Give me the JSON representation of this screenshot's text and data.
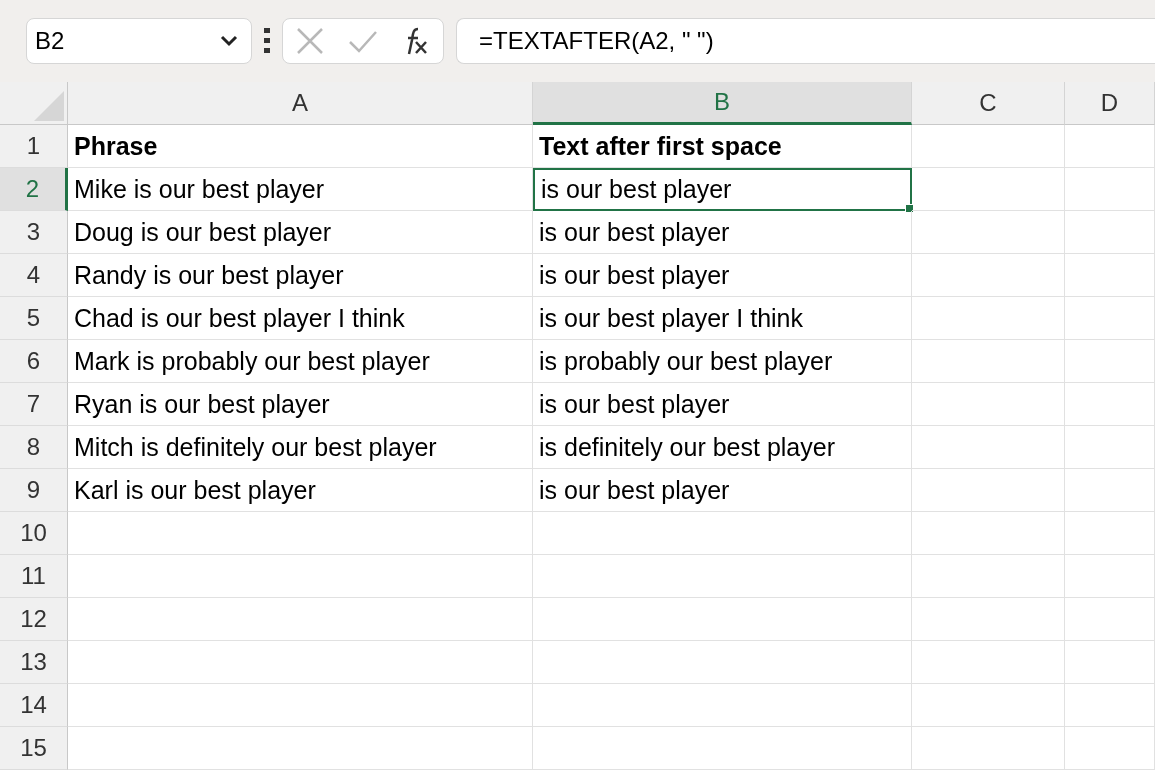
{
  "name_box": {
    "value": "B2"
  },
  "formula_bar": {
    "value": "=TEXTAFTER(A2, \" \")"
  },
  "columns": [
    {
      "label": "A",
      "selected": false
    },
    {
      "label": "B",
      "selected": true
    },
    {
      "label": "C",
      "selected": false
    },
    {
      "label": "D",
      "selected": false
    }
  ],
  "rows": [
    {
      "number": "1",
      "selected": false,
      "kind": "header",
      "cells": [
        {
          "text": "Phrase",
          "selected": false
        },
        {
          "text": "Text after first space",
          "selected": false
        }
      ]
    },
    {
      "number": "2",
      "selected": true,
      "kind": "data",
      "cells": [
        {
          "text": "Mike is our best player",
          "selected": false
        },
        {
          "text": "is our best player",
          "selected": true
        }
      ]
    },
    {
      "number": "3",
      "selected": false,
      "kind": "data",
      "cells": [
        {
          "text": "Doug is our best player",
          "selected": false
        },
        {
          "text": "is our best player",
          "selected": false
        }
      ]
    },
    {
      "number": "4",
      "selected": false,
      "kind": "data",
      "cells": [
        {
          "text": "Randy is our best player",
          "selected": false
        },
        {
          "text": "is our best player",
          "selected": false
        }
      ]
    },
    {
      "number": "5",
      "selected": false,
      "kind": "data",
      "cells": [
        {
          "text": "Chad is our best player I think",
          "selected": false
        },
        {
          "text": "is our best player I think",
          "selected": false
        }
      ]
    },
    {
      "number": "6",
      "selected": false,
      "kind": "data",
      "cells": [
        {
          "text": "Mark is probably our best player",
          "selected": false
        },
        {
          "text": "is probably our best player",
          "selected": false
        }
      ]
    },
    {
      "number": "7",
      "selected": false,
      "kind": "data",
      "cells": [
        {
          "text": "Ryan is our best player",
          "selected": false
        },
        {
          "text": "is our best player",
          "selected": false
        }
      ]
    },
    {
      "number": "8",
      "selected": false,
      "kind": "data",
      "cells": [
        {
          "text": "Mitch is definitely our best player",
          "selected": false
        },
        {
          "text": "is definitely our best player",
          "selected": false
        }
      ]
    },
    {
      "number": "9",
      "selected": false,
      "kind": "data",
      "cells": [
        {
          "text": "Karl is our best player",
          "selected": false
        },
        {
          "text": "is our best player",
          "selected": false
        }
      ]
    },
    {
      "number": "10",
      "selected": false,
      "kind": "data",
      "cells": []
    },
    {
      "number": "11",
      "selected": false,
      "kind": "data",
      "cells": []
    },
    {
      "number": "12",
      "selected": false,
      "kind": "data",
      "cells": []
    },
    {
      "number": "13",
      "selected": false,
      "kind": "data",
      "cells": []
    },
    {
      "number": "14",
      "selected": false,
      "kind": "data",
      "cells": []
    },
    {
      "number": "15",
      "selected": false,
      "kind": "data",
      "cells": []
    }
  ]
}
